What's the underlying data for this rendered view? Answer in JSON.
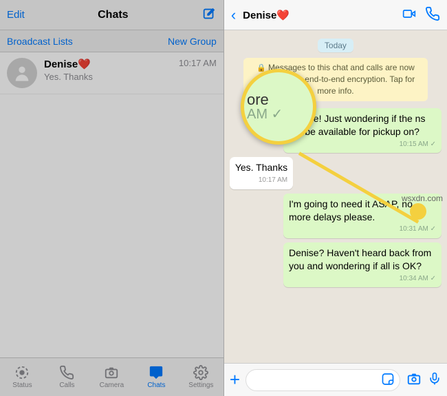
{
  "left": {
    "edit": "Edit",
    "title": "Chats",
    "broadcast": "Broadcast Lists",
    "newgroup": "New Group",
    "chat": {
      "name": "Denise❤️",
      "time": "10:17 AM",
      "snippet": "Yes. Thanks"
    },
    "tabs": {
      "status": "Status",
      "calls": "Calls",
      "camera": "Camera",
      "chats": "Chats",
      "settings": "Settings"
    }
  },
  "right": {
    "contact": "Denise❤️",
    "date": "Today",
    "encryption": "Messages to this chat and calls are now secured with end-to-end encryption. Tap for more info.",
    "messages": [
      {
        "dir": "out",
        "text": "Denise! Just wondering if the ns will be available for pickup on?",
        "time": "10:15 AM"
      },
      {
        "dir": "in",
        "text": "Yes. Thanks",
        "time": "10:17 AM"
      },
      {
        "dir": "out",
        "text": "I'm going to need it ASAP, no more delays please.",
        "time": "10:31 AM"
      },
      {
        "dir": "out",
        "text": "Denise? Haven't heard back from you and wondering if all is OK?",
        "time": "10:34 AM"
      }
    ]
  },
  "magnifier": {
    "top": "ore",
    "bottom": "AM ✓"
  },
  "watermark": "wsxdn.com"
}
